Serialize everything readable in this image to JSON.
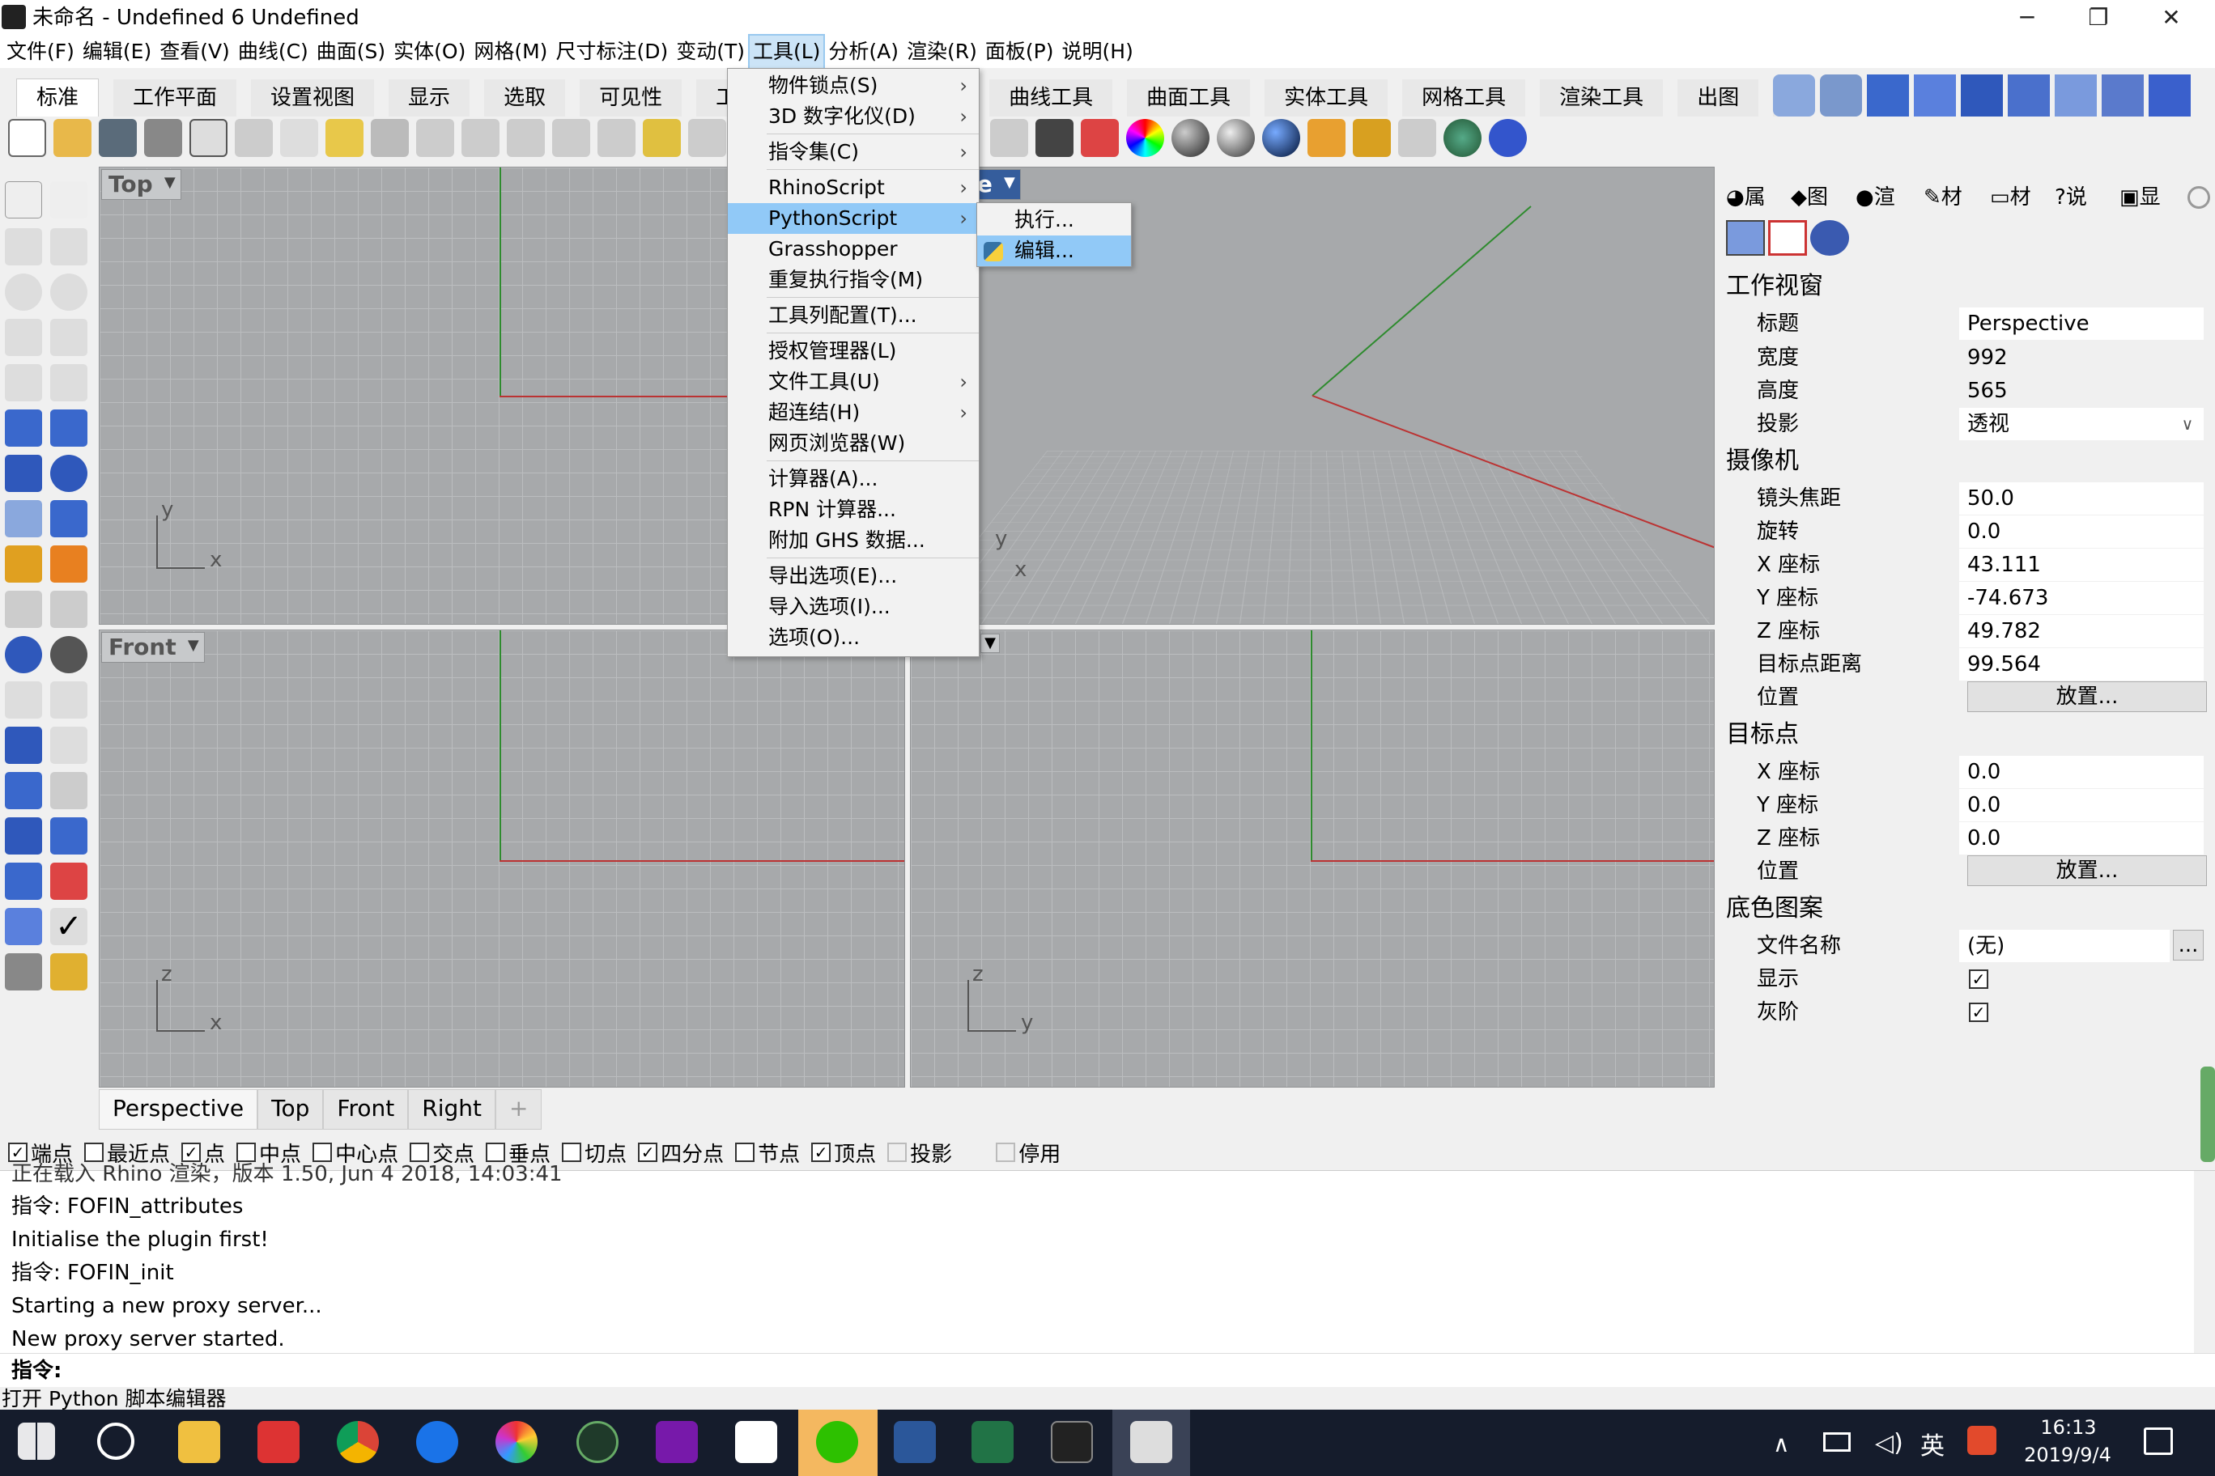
{
  "window": {
    "title": "未命名 - Undefined 6 Undefined",
    "controls": [
      "─",
      "❐",
      "✕"
    ]
  },
  "menubar": [
    "文件(F)",
    "编辑(E)",
    "查看(V)",
    "曲线(C)",
    "曲面(S)",
    "实体(O)",
    "网格(M)",
    "尺寸标注(D)",
    "变动(T)",
    "工具(L)",
    "分析(A)",
    "渲染(R)",
    "面板(P)",
    "说明(H)"
  ],
  "toolbar_tabs": [
    "标准",
    "工作平面",
    "设置视图",
    "显示",
    "选取",
    "可见性",
    "工",
    "曲线工具",
    "曲面工具",
    "实体工具",
    "网格工具",
    "渲染工具",
    "出图",
    "»"
  ],
  "viewports": {
    "top": {
      "label": "Top",
      "x": "x",
      "y": "y"
    },
    "perspective": {
      "label": "ective",
      "x": "x",
      "y": "y"
    },
    "front": {
      "label": "Front",
      "x": "x",
      "z": "z"
    },
    "right": {
      "label": "",
      "y": "y",
      "z": "z"
    }
  },
  "viewport_tabs": [
    "Perspective",
    "Top",
    "Front",
    "Right",
    "+"
  ],
  "osnap": [
    {
      "label": "端点",
      "checked": true
    },
    {
      "label": "最近点",
      "checked": false
    },
    {
      "label": "点",
      "checked": true
    },
    {
      "label": "中点",
      "checked": false
    },
    {
      "label": "中心点",
      "checked": false
    },
    {
      "label": "交点",
      "checked": false
    },
    {
      "label": "垂点",
      "checked": false
    },
    {
      "label": "切点",
      "checked": false
    },
    {
      "label": "四分点",
      "checked": true
    },
    {
      "label": "节点",
      "checked": false
    },
    {
      "label": "顶点",
      "checked": true
    },
    {
      "label": "投影",
      "checked": false,
      "disabled": true
    },
    {
      "label": "停用",
      "checked": false,
      "disabled": true
    }
  ],
  "command_history": [
    "正在载入 Rhino 渲染，版本 1.50, Jun 4 2018, 14:03:41",
    "指令: FOFIN_attributes",
    "Initialise the plugin first!",
    "指令: FOFIN_init",
    "Starting a new proxy server...",
    "New proxy server started."
  ],
  "command_prompt": "指令:",
  "status_text": "打开 Python 脚本编辑器",
  "tools_menu": [
    {
      "label": "物件锁点(S)",
      "submenu": true
    },
    {
      "label": "3D 数字化仪(D)",
      "submenu": true
    },
    {
      "label": "指令集(C)",
      "submenu": true
    },
    {
      "label": "RhinoScript",
      "submenu": true
    },
    {
      "label": "PythonScript",
      "submenu": true,
      "highlighted": true
    },
    {
      "label": "Grasshopper",
      "submenu": false
    },
    {
      "label": "重复执行指令(M)",
      "submenu": false
    },
    {
      "label": "工具列配置(T)...",
      "submenu": false
    },
    {
      "label": "授权管理器(L)",
      "submenu": false
    },
    {
      "label": "文件工具(U)",
      "submenu": true
    },
    {
      "label": "超连结(H)",
      "submenu": true
    },
    {
      "label": "网页浏览器(W)",
      "submenu": false
    },
    {
      "label": "计算器(A)...",
      "submenu": false
    },
    {
      "label": "RPN 计算器...",
      "submenu": false
    },
    {
      "label": "附加 GHS 数据...",
      "submenu": false
    },
    {
      "label": "导出选项(E)...",
      "submenu": false
    },
    {
      "label": "导入选项(I)...",
      "submenu": false
    },
    {
      "label": "选项(O)...",
      "submenu": false
    }
  ],
  "python_submenu": [
    {
      "label": "执行...",
      "highlighted": false
    },
    {
      "label": "编辑...",
      "highlighted": true
    }
  ],
  "panel_tabs": [
    "属",
    "图",
    "渲",
    "材",
    "材",
    "说",
    "显"
  ],
  "properties": {
    "viewport_section": "工作视窗",
    "title_label": "标题",
    "title_value": "Perspective",
    "width_label": "宽度",
    "width_value": "992",
    "height_label": "高度",
    "height_value": "565",
    "projection_label": "投影",
    "projection_value": "透视",
    "camera_section": "摄像机",
    "focal_label": "镜头焦距",
    "focal_value": "50.0",
    "rotation_label": "旋转",
    "rotation_value": "0.0",
    "cam_x_label": "X 座标",
    "cam_x_value": "43.111",
    "cam_y_label": "Y 座标",
    "cam_y_value": "-74.673",
    "cam_z_label": "Z 座标",
    "cam_z_value": "49.782",
    "target_dist_label": "目标点距离",
    "target_dist_value": "99.564",
    "cam_pos_label": "位置",
    "place_button": "放置...",
    "target_section": "目标点",
    "tgt_x_label": "X 座标",
    "tgt_x_value": "0.0",
    "tgt_y_label": "Y 座标",
    "tgt_y_value": "0.0",
    "tgt_z_label": "Z 座标",
    "tgt_z_value": "0.0",
    "tgt_pos_label": "位置",
    "wallpaper_section": "底色图案",
    "filename_label": "文件名称",
    "filename_value": "(无)",
    "browse_button": "...",
    "show_label": "显示",
    "show_checked": true,
    "gray_label": "灰阶",
    "gray_checked": true
  },
  "taskbar": {
    "time": "16:13",
    "date": "2019/9/4",
    "ime": "英",
    "tray_icons": [
      "chevron-up-icon",
      "battery-icon",
      "volume-icon"
    ]
  },
  "colors": {
    "viewport_bg": "#a7a9ab",
    "menu_highlight": "#91c9f7",
    "taskbar_bg": "#151c2c",
    "axis_x": "#b33333",
    "axis_y": "#2e8b2e"
  }
}
